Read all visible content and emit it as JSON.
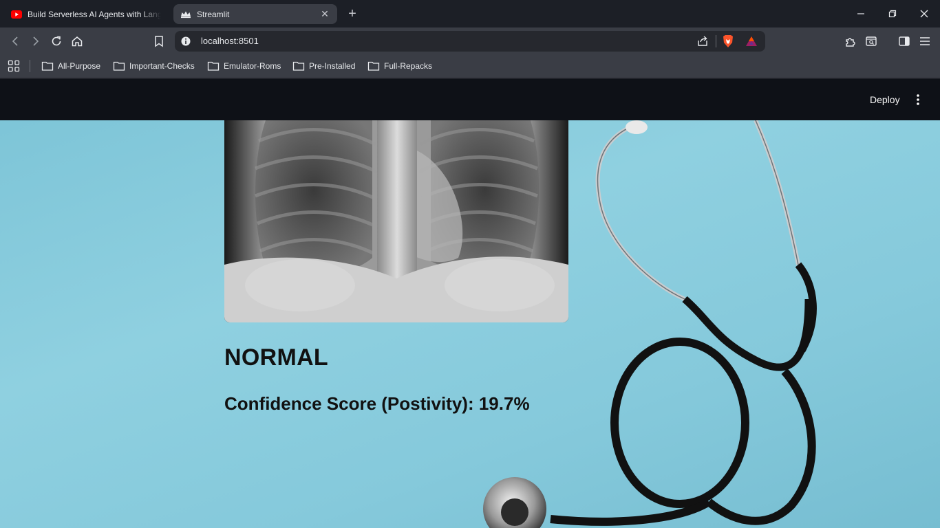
{
  "browser": {
    "tabs": [
      {
        "title": "Build Serverless AI Agents with Langb",
        "icon": "youtube-icon",
        "active": false
      },
      {
        "title": "Streamlit",
        "icon": "streamlit-crown-icon",
        "active": true
      }
    ],
    "url": "localhost:8501",
    "bookmarks": [
      "All-Purpose",
      "Important-Checks",
      "Emulator-Roms",
      "Pre-Installed",
      "Full-Repacks"
    ]
  },
  "app": {
    "deploy_label": "Deploy",
    "image_description_icon": "chest-xray-image",
    "prediction": "NORMAL",
    "confidence_text": "Confidence Score (Postivity): 19.7%",
    "colors": {
      "header": "#0e1117",
      "background": "#8fd0e0",
      "text": "#111111"
    }
  }
}
